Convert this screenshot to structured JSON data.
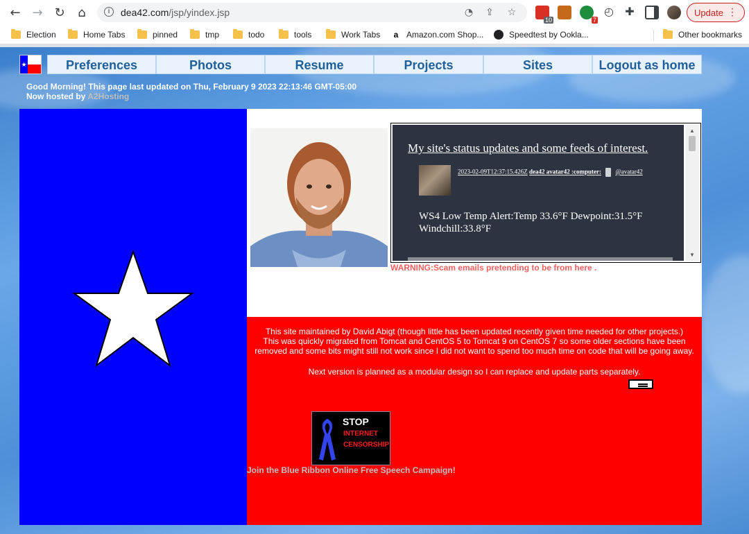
{
  "browser": {
    "url_host": "dea42.com",
    "url_path": "/jsp/yindex.jsp",
    "extension_badges": [
      "10",
      "7"
    ],
    "update_label": "Update",
    "menu_dots": "⋮"
  },
  "bookmarks": [
    {
      "label": "Election",
      "icon": "folder-icon"
    },
    {
      "label": "Home Tabs",
      "icon": "folder-icon"
    },
    {
      "label": "pinned",
      "icon": "folder-icon"
    },
    {
      "label": "tmp",
      "icon": "folder-icon"
    },
    {
      "label": "todo",
      "icon": "folder-icon"
    },
    {
      "label": "tools",
      "icon": "folder-icon"
    },
    {
      "label": "Work Tabs",
      "icon": "folder-icon"
    },
    {
      "label": "Amazon.com Shop...",
      "icon": "amazon-icon"
    },
    {
      "label": "Speedtest by Ookla...",
      "icon": "speedtest-icon"
    },
    {
      "label": "Other bookmarks",
      "icon": "folder-icon"
    }
  ],
  "nav": {
    "tabs": [
      "Preferences",
      "Photos",
      "Resume",
      "Projects",
      "Sites",
      "Logout as home"
    ]
  },
  "header": {
    "greeting": "Good Morning! This page last updated on Thu, February 9 2023 22:13:46 GMT-05:00",
    "hosted_prefix": "Now hosted by ",
    "hosted_link": "A2Hosting"
  },
  "feed": {
    "title": "My site's status updates and some feeds of interest.",
    "timestamp": "2023-02-09T12:37:15.426Z",
    "author": "dea42 avatar42 :computer:",
    "handle": "@avatar42",
    "body": "WS4 Low Temp Alert:Temp 33.6°F Dewpoint:31.5°F Windchill:33.8°F"
  },
  "warning": "WARNING:Scam emails pretending to be from here .",
  "maintenance": {
    "lines": [
      "This site maintained by David Abigt (though little has been updated recently given time needed for other projects.)",
      "This was quickly migrated from Tomcat and CentOS 5 to Tomcat 9 on CentOS 7 so some older sections have been",
      "removed and some bits might still not work since I did not want to spend too much time on code that will be going away."
    ],
    "next_version": "Next version is planned as a modular design so I can replace and update parts separately."
  },
  "banner": {
    "stop": "STOP",
    "line1": "INTERNET",
    "line2": "CENSORSHIP",
    "caption": "Join the Blue Ribbon Online Free Speech Campaign!"
  },
  "colors": {
    "flag_blue": "#0000ff",
    "flag_red": "#ff0000",
    "flag_white": "#ffffff",
    "nav_text": "#1f5f9a",
    "warning": "#f06060"
  }
}
